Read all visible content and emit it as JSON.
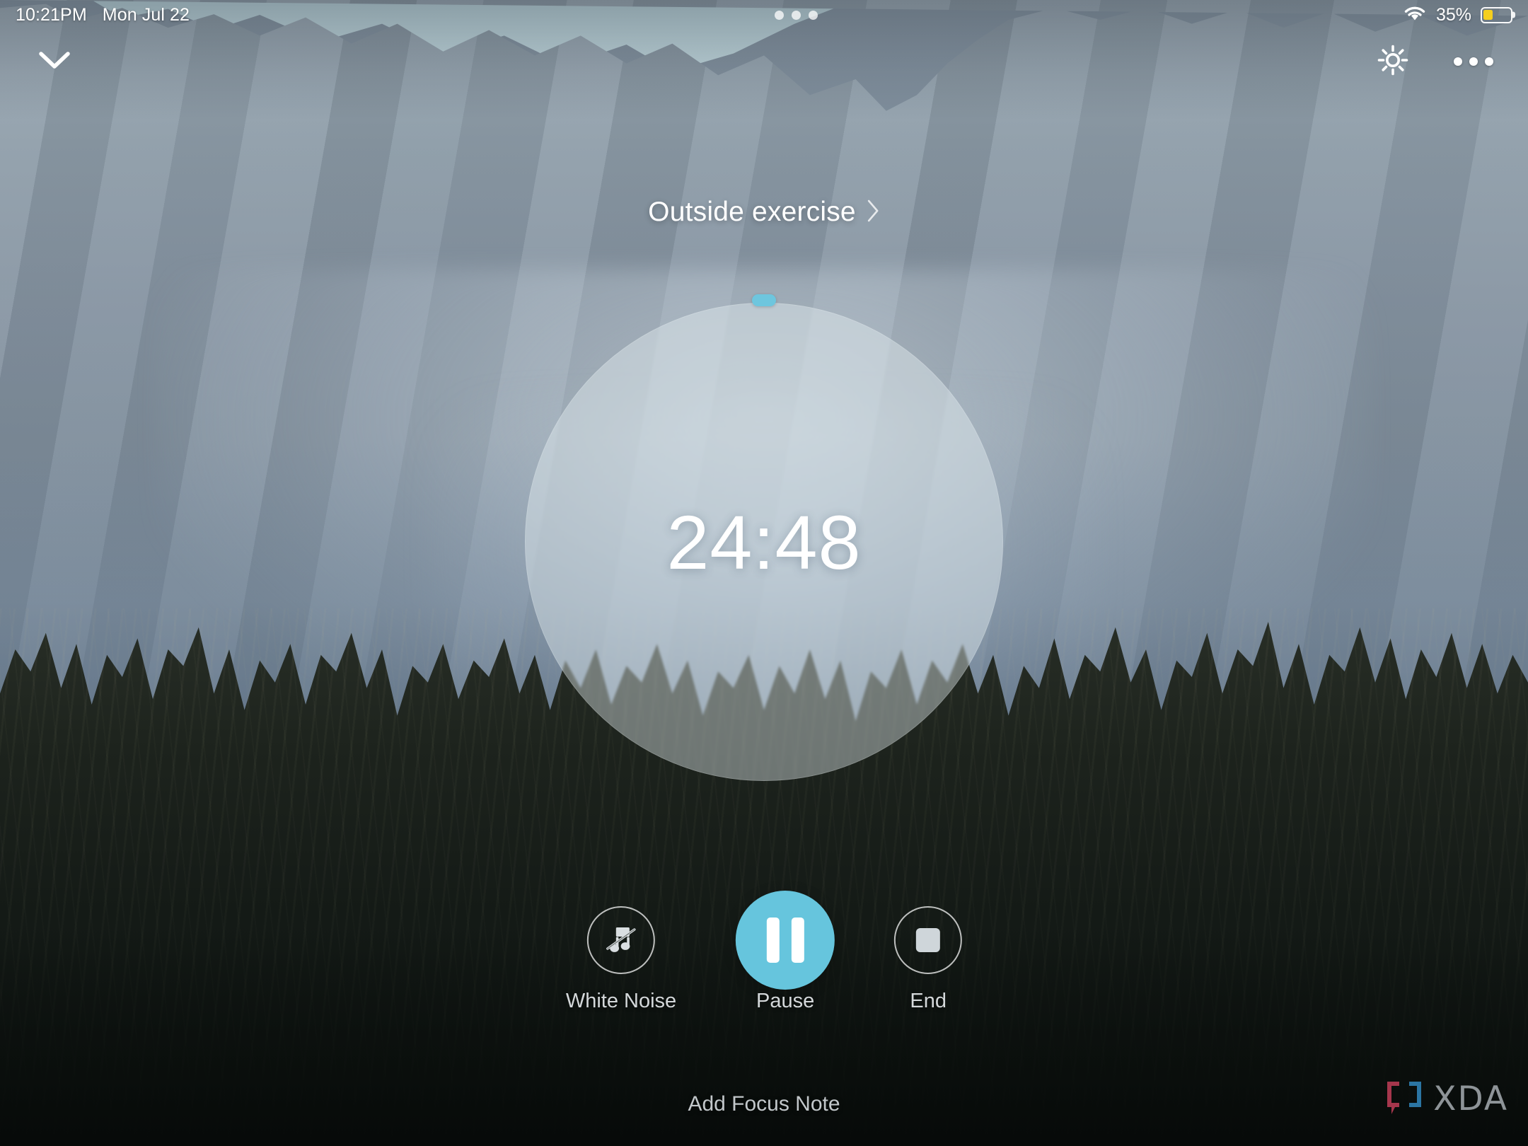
{
  "status_bar": {
    "time": "10:21PM",
    "date": "Mon Jul 22",
    "page_dots": 3,
    "wifi_icon": "wifi-icon",
    "battery_percent": "35%",
    "battery_level": 35,
    "battery_color": "#f5cf1e"
  },
  "top_bar": {
    "collapse_icon": "chevron-down-icon",
    "brightness_icon": "brightness-sun-icon",
    "more_icon": "more-horizontal-icon"
  },
  "session": {
    "label": "Outside exercise",
    "chevron_icon": "chevron-right-icon"
  },
  "timer": {
    "value": "24:48",
    "marker_color": "#6ec6de",
    "circle_fill": "rgba(236,244,248,0.40)"
  },
  "controls": {
    "white_noise": {
      "label": "White Noise",
      "icon": "music-note-off-icon"
    },
    "pause": {
      "label": "Pause",
      "icon": "pause-icon",
      "accent_color": "#66c5dd"
    },
    "end": {
      "label": "End",
      "icon": "stop-square-icon"
    }
  },
  "footer": {
    "add_note_label": "Add Focus Note"
  },
  "watermark": {
    "text": "XDA",
    "bracket_left_color": "#b33a52",
    "bracket_right_color": "#2e7eb0"
  }
}
